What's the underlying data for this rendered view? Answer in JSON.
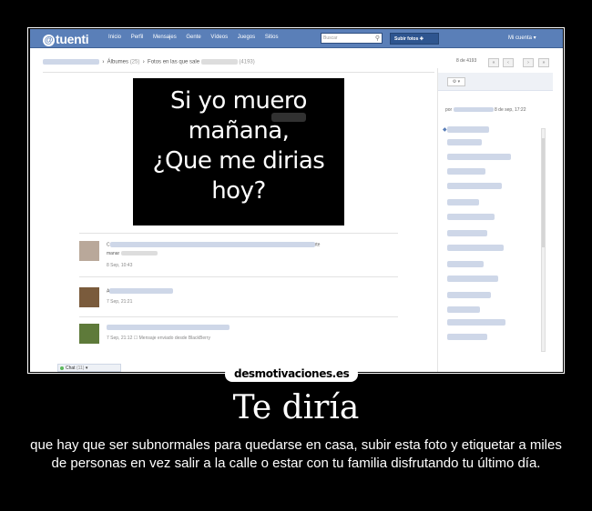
{
  "app": {
    "logo": "tuenti",
    "nav": [
      "Inicio",
      "Perfil",
      "Mensajes",
      "Gente",
      "Vídeos",
      "Juegos",
      "Sitios"
    ],
    "search_placeholder": "Buscar",
    "upload_label": "Subir fotos",
    "account_label": "Mi cuenta ▾"
  },
  "breadcrumb": {
    "albums": "Álbumes",
    "albums_count": "(25)",
    "photos_in_which": "Fotos en las que sale",
    "photos_count": "(4193)"
  },
  "pager": {
    "position": "8 de 4193",
    "buttons": [
      "«",
      "‹",
      "›",
      "»"
    ]
  },
  "photo": {
    "lines": [
      "Si yo muero",
      "mañana,",
      "¿Que me dirias",
      "hoy?"
    ]
  },
  "comments": [
    {
      "prefix": "C",
      "tail": "rte",
      "line2": "manar",
      "time": "8 Sep, 10:43",
      "avatar_color": "#b9a89a"
    },
    {
      "prefix": "A",
      "tail": "",
      "line2": "",
      "time": "7 Sep, 21:21",
      "avatar_color": "#7a5b3c"
    },
    {
      "prefix": "",
      "tail": "",
      "line2": "",
      "time": "7 Sep, 21:12",
      "note": "Mensaje enviado desde BlackBerry",
      "avatar_color": "#5e7a3a"
    }
  ],
  "sidebar": {
    "select_label": "▾",
    "uploaded_by_prefix": "por",
    "uploaded_date": "8 de sep, 17:22"
  },
  "chat": {
    "label": "Chat",
    "count": "(11)"
  },
  "watermark": "desmotivaciones.es",
  "poster": {
    "title": "Te diría",
    "description": "que hay que ser subnormales para quedarse en casa, subir esta foto y etiquetar a miles de personas en vez salir a la calle o estar con tu familia disfrutando tu último día."
  }
}
